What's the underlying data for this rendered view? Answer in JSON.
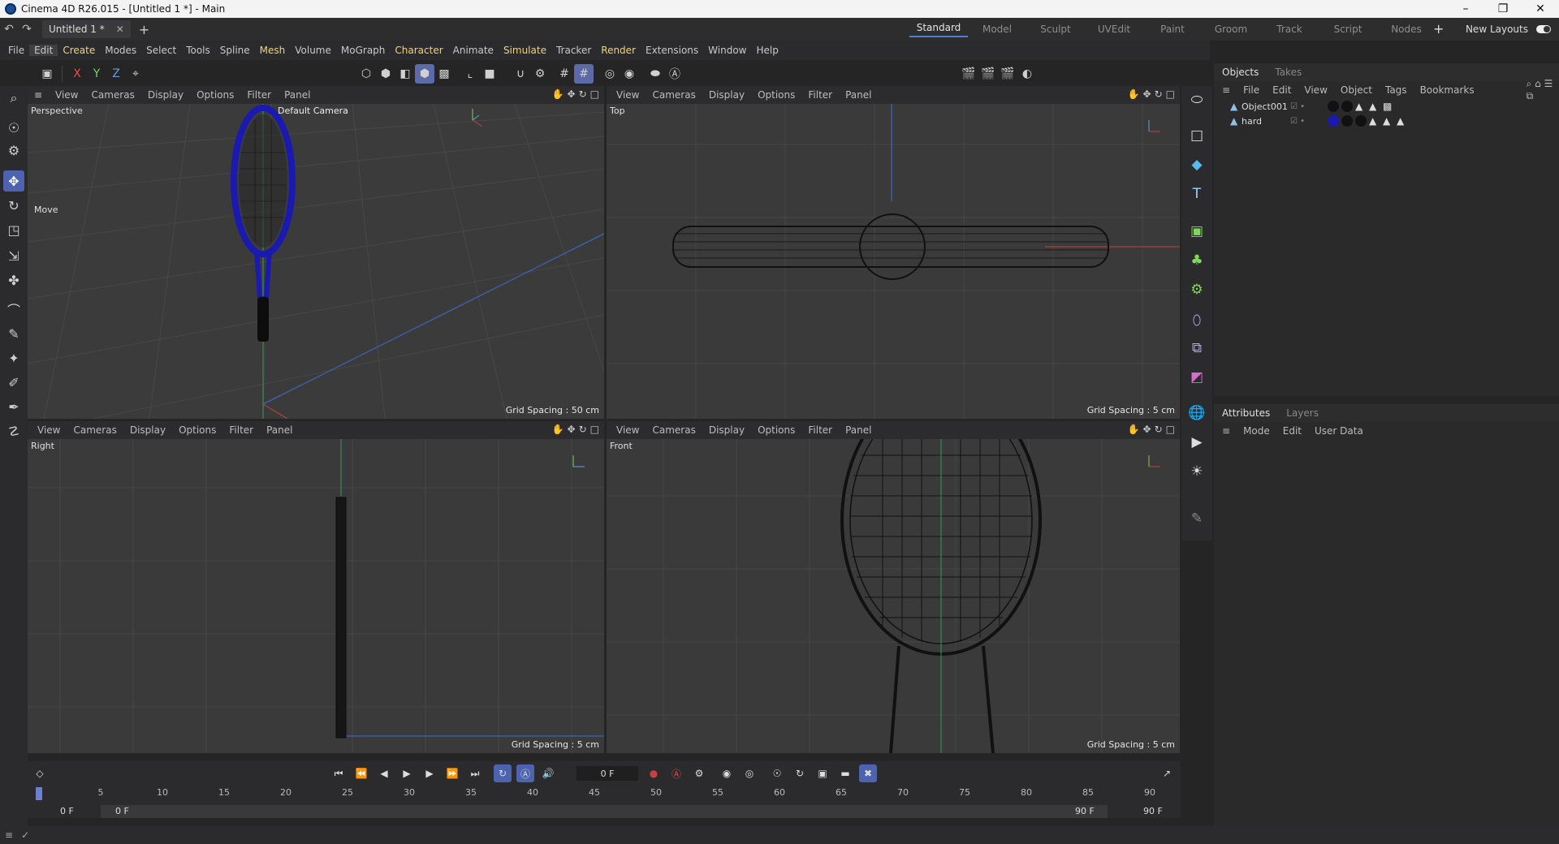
{
  "window": {
    "title": "Cinema 4D R26.015 - [Untitled 1 *] - Main",
    "min": "–",
    "max": "❐",
    "close": "✕"
  },
  "doc_tab": {
    "label": "Untitled 1 *",
    "close": "✕",
    "add": "+"
  },
  "layouts": {
    "items": [
      "Standard",
      "Model",
      "Sculpt",
      "UVEdit",
      "Paint",
      "Groom",
      "Track",
      "Script",
      "Nodes"
    ],
    "active": "Standard",
    "plus": "+",
    "new_layouts": "New Layouts"
  },
  "menu": [
    "File",
    "Edit",
    "Create",
    "Modes",
    "Select",
    "Tools",
    "Spline",
    "Mesh",
    "Volume",
    "MoGraph",
    "Character",
    "Animate",
    "Simulate",
    "Tracker",
    "Render",
    "Extensions",
    "Window",
    "Help"
  ],
  "menu_highlight": [
    "Create",
    "Mesh",
    "Character",
    "Simulate",
    "Render"
  ],
  "menu_selected": "Edit",
  "axis_buttons": {
    "x": "X",
    "y": "Y",
    "z": "Z"
  },
  "viewport_menu": [
    "View",
    "Cameras",
    "Display",
    "Options",
    "Filter",
    "Panel"
  ],
  "viewports": {
    "perspective": {
      "label": "Perspective",
      "camera": "Default Camera",
      "grid": "Grid Spacing : 50 cm",
      "tool_label": "Move"
    },
    "top": {
      "label": "Top",
      "grid": "Grid Spacing : 5 cm"
    },
    "right": {
      "label": "Right",
      "grid": "Grid Spacing : 5 cm"
    },
    "front": {
      "label": "Front",
      "grid": "Grid Spacing : 5 cm"
    }
  },
  "objects_panel": {
    "tabs": [
      "Objects",
      "Takes"
    ],
    "menu": [
      "File",
      "Edit",
      "View",
      "Object",
      "Tags",
      "Bookmarks"
    ],
    "rows": [
      {
        "name": "Object001"
      },
      {
        "name": "hard"
      }
    ]
  },
  "attributes_panel": {
    "tabs": [
      "Attributes",
      "Layers"
    ],
    "menu": [
      "Mode",
      "Edit",
      "User Data"
    ]
  },
  "timeline": {
    "current_frame": "0 F",
    "ticks": [
      "0",
      "5",
      "10",
      "15",
      "20",
      "25",
      "30",
      "35",
      "40",
      "45",
      "50",
      "55",
      "60",
      "65",
      "70",
      "75",
      "80",
      "85",
      "90"
    ],
    "range_start": "0 F",
    "range_start2": "0 F",
    "range_end": "90 F",
    "range_end2": "90 F"
  },
  "colors": {
    "accent": "#4c7fd6",
    "racket": "#1a1ab0",
    "menu_highlight": "#f3d27a"
  }
}
